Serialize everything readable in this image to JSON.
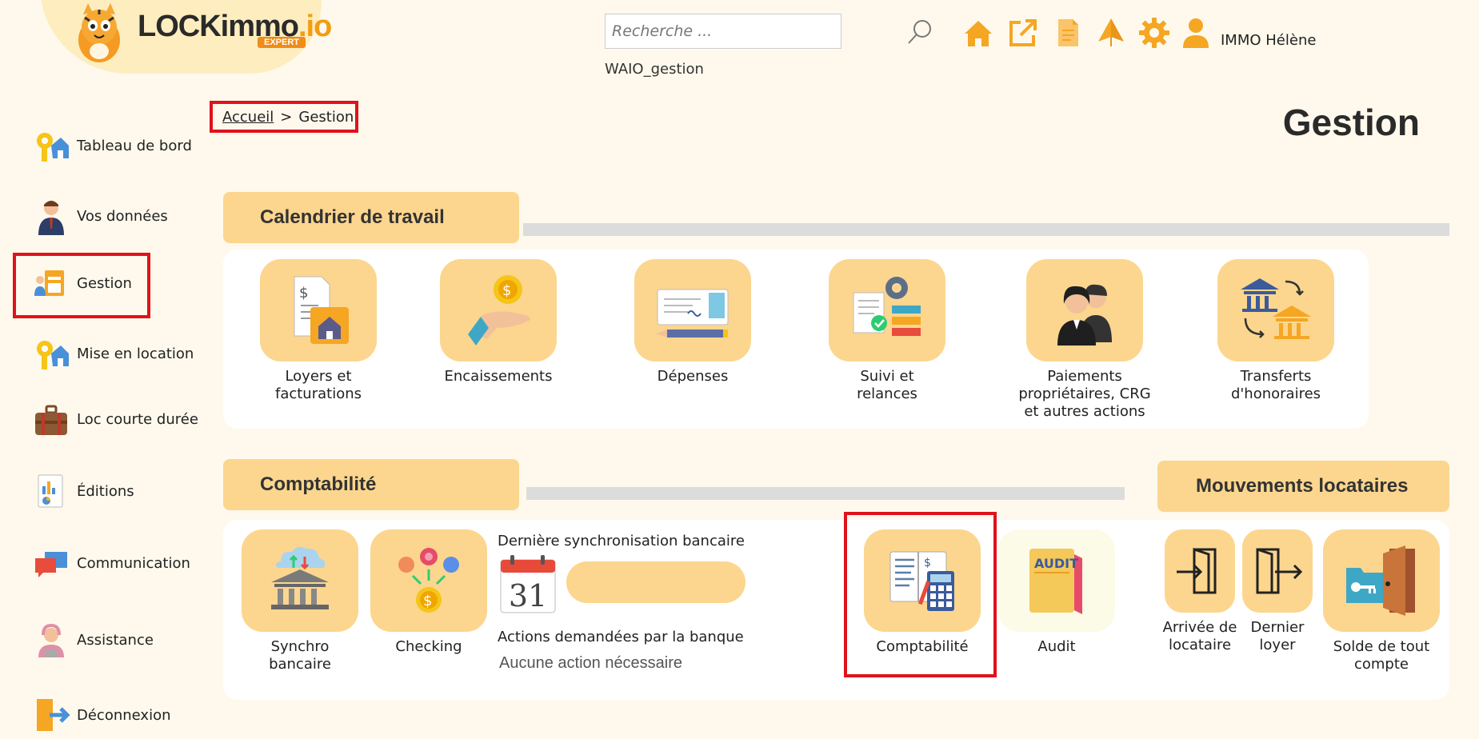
{
  "logo": {
    "brand": "LOCKimmo",
    "brand_suffix": ".io",
    "badge": "EXPERT"
  },
  "header": {
    "search_placeholder": "Recherche ...",
    "subtitle": "WAIO_gestion",
    "username": "IMMO Hélène",
    "icons": [
      "home-icon",
      "external-link-icon",
      "document-icon",
      "sailboat-icon",
      "gear-icon",
      "user-icon"
    ]
  },
  "breadcrumb": {
    "home": "Accueil",
    "separator": ">",
    "current": "Gestion"
  },
  "page_title": "Gestion",
  "sidebar": {
    "items": [
      {
        "label": "Tableau de bord",
        "icon": "dashboard-key-house-icon"
      },
      {
        "label": "Vos données",
        "icon": "person-icon"
      },
      {
        "label": "Gestion",
        "icon": "management-icon"
      },
      {
        "label": "Mise en location",
        "icon": "rental-key-house-icon"
      },
      {
        "label": "Loc courte durée",
        "icon": "suitcase-icon"
      },
      {
        "label": "Éditions",
        "icon": "report-icon"
      },
      {
        "label": "Communication",
        "icon": "chat-bubbles-icon"
      },
      {
        "label": "Assistance",
        "icon": "support-agent-icon"
      },
      {
        "label": "Déconnexion",
        "icon": "logout-icon"
      }
    ]
  },
  "sections": {
    "calendrier": {
      "title": "Calendrier de travail",
      "tiles": [
        {
          "label": "Loyers et\nfacturations",
          "icon": "rent-invoice-icon"
        },
        {
          "label": "Encaissements",
          "icon": "coin-hand-icon"
        },
        {
          "label": "Dépenses",
          "icon": "cheque-icon"
        },
        {
          "label": "Suivi et\nrelances",
          "icon": "follow-up-icon"
        },
        {
          "label": "Paiements\npropriétaires, CRG\net autres actions",
          "icon": "owners-icon"
        },
        {
          "label": "Transferts\nd'honoraires",
          "icon": "bank-transfer-icon"
        }
      ]
    },
    "comptabilite": {
      "title": "Comptabilité",
      "tiles": [
        {
          "label": "Synchro\nbancaire",
          "icon": "bank-sync-icon"
        },
        {
          "label": "Checking",
          "icon": "coins-check-icon"
        },
        {
          "label": "Comptabilité",
          "icon": "ledger-calculator-icon"
        },
        {
          "label": "Audit",
          "icon": "audit-folder-icon"
        }
      ],
      "sync_title": "Dernière synchronisation bancaire",
      "calendar_day": "31",
      "actions_title": "Actions demandées par la banque",
      "actions_value": "Aucune action nécessaire"
    },
    "mouvements": {
      "title": "Mouvements locataires",
      "tiles": [
        {
          "label": "Arrivée de\nlocataire",
          "icon": "door-enter-icon"
        },
        {
          "label": "Dernier\nloyer",
          "icon": "door-exit-icon"
        },
        {
          "label": "Solde de tout\ncompte",
          "icon": "folder-key-door-icon"
        }
      ]
    }
  },
  "colors": {
    "accent": "#f5a623",
    "tile_bg": "#fcd68e",
    "highlight": "#e0121b",
    "page_bg": "#fef9ec"
  }
}
